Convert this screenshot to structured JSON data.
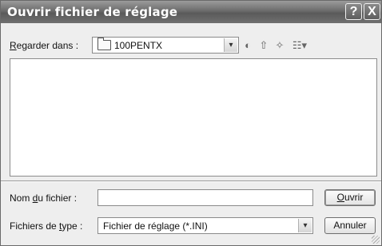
{
  "dialog": {
    "title": "Ouvrir fichier de réglage",
    "help_glyph": "?",
    "close_glyph": "X"
  },
  "lookin": {
    "label_pre": "",
    "label_key": "R",
    "label_post": "egarder dans :",
    "value": "100PENTX",
    "dropdown_glyph": "▾"
  },
  "toolbar": {
    "back_glyph": "◐",
    "up_glyph": "⇧",
    "newfolder_glyph": "✧",
    "view_glyph": "☷▾"
  },
  "filename": {
    "label_pre": "Nom ",
    "label_key": "d",
    "label_post": "u fichier :",
    "value": ""
  },
  "filetype": {
    "label_pre": "Fichiers de ",
    "label_key": "t",
    "label_post": "ype :",
    "value": "Fichier de réglage (*.INI)",
    "dropdown_glyph": "▾"
  },
  "buttons": {
    "open_key": "O",
    "open_rest": "uvrir",
    "cancel": "Annuler"
  }
}
